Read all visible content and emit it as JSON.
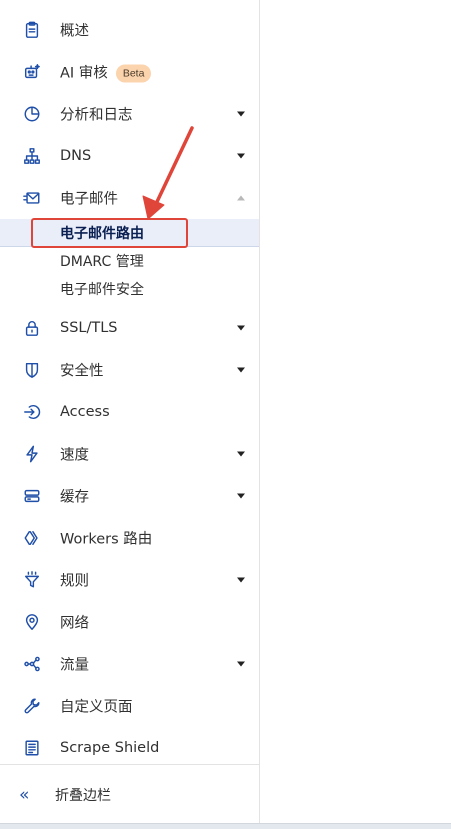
{
  "sidebar": {
    "items": [
      {
        "label": "概述",
        "icon": "document-icon",
        "caret": ""
      },
      {
        "label": "AI 审核",
        "icon": "robot-icon",
        "caret": "",
        "badge": "Beta"
      },
      {
        "label": "分析和日志",
        "icon": "pie-chart-icon",
        "caret": "down"
      },
      {
        "label": "DNS",
        "icon": "network-icon",
        "caret": "down"
      },
      {
        "label": "电子邮件",
        "icon": "envelope-icon",
        "caret": "up"
      },
      {
        "label": "SSL/TLS",
        "icon": "lock-icon",
        "caret": "down"
      },
      {
        "label": "安全性",
        "icon": "shield-icon",
        "caret": "down"
      },
      {
        "label": "Access",
        "icon": "access-icon",
        "caret": ""
      },
      {
        "label": "速度",
        "icon": "lightning-icon",
        "caret": "down"
      },
      {
        "label": "缓存",
        "icon": "server-icon",
        "caret": "down"
      },
      {
        "label": "Workers 路由",
        "icon": "workers-icon",
        "caret": ""
      },
      {
        "label": "规则",
        "icon": "funnel-icon",
        "caret": "down"
      },
      {
        "label": "网络",
        "icon": "location-pin-icon",
        "caret": ""
      },
      {
        "label": "流量",
        "icon": "traffic-icon",
        "caret": "down"
      },
      {
        "label": "自定义页面",
        "icon": "wrench-icon",
        "caret": ""
      },
      {
        "label": "Scrape Shield",
        "icon": "scrape-icon",
        "caret": ""
      }
    ],
    "email_subitems": [
      {
        "label": "电子邮件路由",
        "active": true
      },
      {
        "label": "DMARC 管理",
        "active": false
      },
      {
        "label": "电子邮件安全",
        "active": false
      }
    ],
    "collapse_label": "折叠边栏"
  },
  "colors": {
    "accent": "#1f4fa8",
    "annotation_red": "#e0453a",
    "badge_bg": "#fbd3ad",
    "active_bg": "#e9eef8"
  }
}
